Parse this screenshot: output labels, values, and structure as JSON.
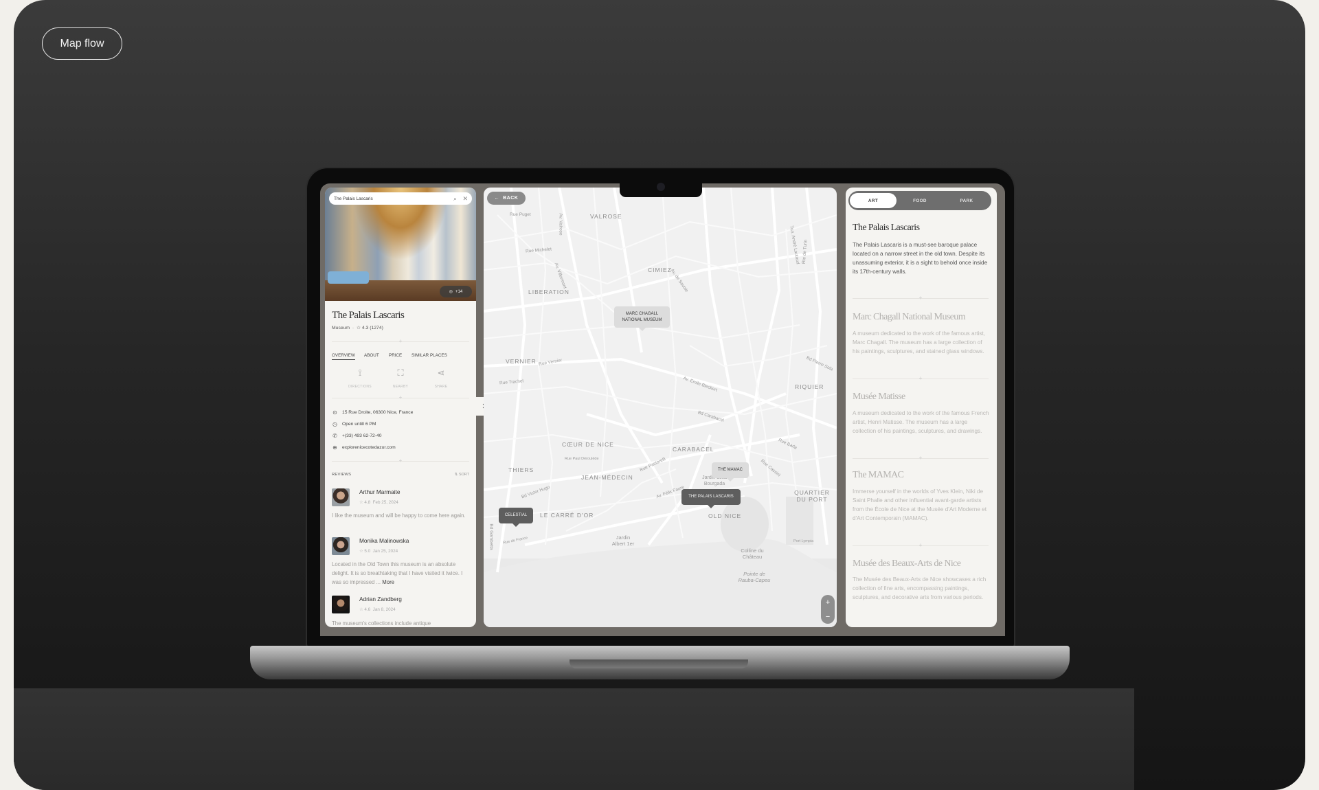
{
  "header": {
    "label": "Map flow"
  },
  "detail": {
    "search_value": "The Palais Lascaris",
    "photo_count": "+14",
    "title": "The Palais Lascaris",
    "category": "Museum",
    "rating": "4.3 (1274)",
    "tabs": [
      {
        "label": "OVERVIEW",
        "active": true
      },
      {
        "label": "ABOUT"
      },
      {
        "label": "PRICE"
      },
      {
        "label": "SIMILAR PLACES"
      }
    ],
    "actions": [
      {
        "label": "DIRECTIONS",
        "icon": "route-icon"
      },
      {
        "label": "NEARBY",
        "icon": "map-search-icon"
      },
      {
        "label": "SHARE",
        "icon": "share-icon"
      }
    ],
    "info": {
      "address": "15 Rue Droite, 06300 Nice, France",
      "hours": "Open untill 6 PM",
      "phone": "+(33) 493 62-72-40",
      "website": "explorenicecotedazur.com"
    },
    "reviews_label": "REVIEWS",
    "sort_label": "SORT",
    "reviews": [
      {
        "name": "Arthur Marmaite",
        "rating": "4.8",
        "date": "Feb 25, 2024",
        "text": "I like the museum and will be happy to come here again."
      },
      {
        "name": "Monika Malinowska",
        "rating": "5.0",
        "date": "Jan 25, 2024",
        "text": "Located in the Old Town this museum is an absolute delight. It is so breathtaking that I have visited it twice. I was so impressed ...",
        "more": "More"
      },
      {
        "name": "Adrian Zandberg",
        "rating": "4.6",
        "date": "Jan 8, 2024",
        "text": "The museum's collections include antique"
      }
    ]
  },
  "map": {
    "back_label": "BACK",
    "districts": [
      "VALROSE",
      "CIMIEZ",
      "LIBERATION",
      "VERNIER",
      "RIQUIER",
      "CŒUR DE NICE",
      "CARABACEL",
      "THIERS",
      "JEAN-MÉDECIN",
      "LE CARRÉ D'OR",
      "OLD NICE",
      "QUARTIER DU PORT"
    ],
    "streets": [
      "Rue Puget",
      "Rue Michelet",
      "Rue Vernier",
      "Rue Trachel",
      "Bd Pierre Sola",
      "Av. Emile Bieckert",
      "Rue Paul Déroulède",
      "Bd Victor Hugo",
      "Bd Carabacel",
      "Rue Pastorelli",
      "Rue Barla",
      "Rue Cassini",
      "Av. Valrose",
      "Av. Villermont",
      "Av. de Savoie",
      "Tun. André Lautaud",
      "Rte de Turin",
      "Rue de France",
      "Port Lympia",
      "Bd Gambetta",
      "Av. Félix Faure"
    ],
    "places": [
      "Jardin Albert 1er",
      "Colline du Château",
      "Pointe de Rauba-Capeu",
      "Jardin della Bourgada"
    ],
    "pins": [
      {
        "label": "MARC CHAGALL NATIONAL MUSEUM",
        "style": "light"
      },
      {
        "label": "THE MAMAC",
        "style": "light"
      },
      {
        "label": "THE PALAIS LASCARIS",
        "style": "dark"
      },
      {
        "label": "CELESTIAL",
        "style": "dark"
      }
    ],
    "zoom_in": "+",
    "zoom_out": "−"
  },
  "list": {
    "tabs": [
      {
        "label": "ART",
        "active": true
      },
      {
        "label": "FOOD"
      },
      {
        "label": "PARK"
      }
    ],
    "items": [
      {
        "title": "The Palais Lascaris",
        "desc": "The Palais Lascaris is a must-see baroque palace located on a narrow street in the old town. Despite its unassuming exterior, it is a sight to behold once inside its 17th-century walls.",
        "active": true
      },
      {
        "title": "Marc Chagall National Museum",
        "desc": "A museum dedicated to the work of the famous artist, Marc Chagall. The museum has a large collection of his paintings, sculptures, and stained glass windows."
      },
      {
        "title": "Musée Matisse",
        "desc": "A museum dedicated to the work of the famous French artist, Henri Matisse. The museum has a large collection of his paintings, sculptures, and drawings."
      },
      {
        "title": "The MAMAC",
        "desc": "Immerse yourself in the worlds of Yves Klein, Niki de Saint Phalle and other influential avant-garde artists from the École de Nice at the Musée d'Art Moderne et d'Art Contemporain (MAMAC)."
      },
      {
        "title": "Musée des Beaux-Arts de Nice",
        "desc": "The Musée des Beaux-Arts de Nice showcases a rich collection of fine arts, encompassing paintings, sculptures, and decorative arts from various periods."
      }
    ]
  },
  "colors": {
    "panel": "#f5f4f1",
    "screen": "#6f6b66",
    "map": "#f1f1f1",
    "pin_dark": "#5e5e5e"
  }
}
